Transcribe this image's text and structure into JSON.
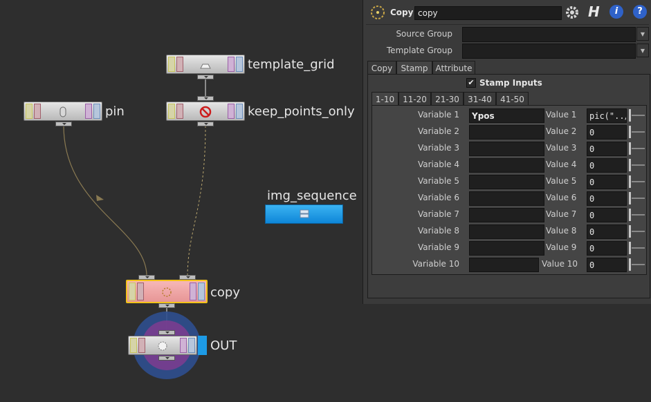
{
  "network": {
    "nodes": {
      "template_grid": {
        "label": "template_grid",
        "icon": "grid-icon"
      },
      "keep_points_only": {
        "label": "keep_points_only",
        "icon": "no-entry-icon"
      },
      "pin": {
        "label": "pin",
        "icon": "pin-icon"
      },
      "img_sequence": {
        "label": "img_sequence",
        "icon": "stack-icon"
      },
      "copy": {
        "label": "copy",
        "icon": "copy-sop-icon"
      },
      "out": {
        "label": "OUT",
        "icon": "null-icon"
      }
    },
    "colors": {
      "wire": "#8a7a52",
      "copy_node": "#f0a6a6",
      "selected_outline": "#f2c31a",
      "out_flag": "#1d9be6",
      "display_ring": "#2f4f8f",
      "render_ring": "#7a3d8f"
    }
  },
  "pane": {
    "node_type": "Copy",
    "node_name": "copy",
    "icons": {
      "node": "copy-sop-icon",
      "gear": "gear-icon",
      "houdini": "houdini-icon",
      "info": "info-icon",
      "help": "help-icon"
    },
    "source_group_label": "Source Group",
    "source_group_value": "",
    "template_group_label": "Template Group",
    "template_group_value": "",
    "tabs": [
      "Copy",
      "Stamp",
      "Attribute"
    ],
    "active_tab": "Stamp",
    "stamp_inputs_label": "Stamp Inputs",
    "stamp_inputs_checked": true,
    "subtabs": [
      "1-10",
      "11-20",
      "21-30",
      "31-40",
      "41-50"
    ],
    "active_subtab": "1-10",
    "rows": [
      {
        "var_label": "Variable 1",
        "var_value": "Ypos",
        "val_label": "Value 1",
        "val_value": "pic(\"../"
      },
      {
        "var_label": "Variable 2",
        "var_value": "",
        "val_label": "Value 2",
        "val_value": "0"
      },
      {
        "var_label": "Variable 3",
        "var_value": "",
        "val_label": "Value 3",
        "val_value": "0"
      },
      {
        "var_label": "Variable 4",
        "var_value": "",
        "val_label": "Value 4",
        "val_value": "0"
      },
      {
        "var_label": "Variable 5",
        "var_value": "",
        "val_label": "Value 5",
        "val_value": "0"
      },
      {
        "var_label": "Variable 6",
        "var_value": "",
        "val_label": "Value 6",
        "val_value": "0"
      },
      {
        "var_label": "Variable 7",
        "var_value": "",
        "val_label": "Value 7",
        "val_value": "0"
      },
      {
        "var_label": "Variable 8",
        "var_value": "",
        "val_label": "Value 8",
        "val_value": "0"
      },
      {
        "var_label": "Variable 9",
        "var_value": "",
        "val_label": "Value 9",
        "val_value": "0"
      },
      {
        "var_label": "Variable 10",
        "var_value": "",
        "val_label": "Value 10",
        "val_value": "0"
      }
    ]
  }
}
